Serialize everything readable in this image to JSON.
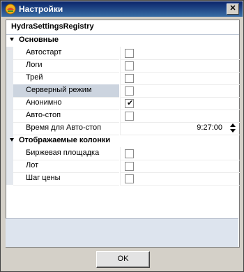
{
  "window": {
    "title": "Настройки",
    "close_label": "✕"
  },
  "grid": {
    "header": "HydraSettingsRegistry",
    "categories": [
      {
        "label": "Основные",
        "properties": [
          {
            "label": "Автостарт",
            "type": "checkbox",
            "checked": false
          },
          {
            "label": "Логи",
            "type": "checkbox",
            "checked": false
          },
          {
            "label": "Трей",
            "type": "checkbox",
            "checked": false
          },
          {
            "label": "Серверный режим",
            "type": "checkbox",
            "checked": false,
            "selected": true
          },
          {
            "label": "Анонимно",
            "type": "checkbox",
            "checked": true
          },
          {
            "label": "Авто-стоп",
            "type": "checkbox",
            "checked": false
          },
          {
            "label": "Время для Авто-стоп",
            "type": "time",
            "value": "9:27:00"
          }
        ]
      },
      {
        "label": "Отображаемые колонки",
        "properties": [
          {
            "label": "Биржевая площадка",
            "type": "checkbox",
            "checked": false
          },
          {
            "label": "Лот",
            "type": "checkbox",
            "checked": false
          },
          {
            "label": "Шаг цены",
            "type": "checkbox",
            "checked": false
          }
        ]
      }
    ]
  },
  "footer": {
    "ok_label": "OK"
  },
  "colors": {
    "title_bar": "#0a246a",
    "selected_row": "#ccd4df",
    "bottom_panel": "#dde4ee"
  }
}
